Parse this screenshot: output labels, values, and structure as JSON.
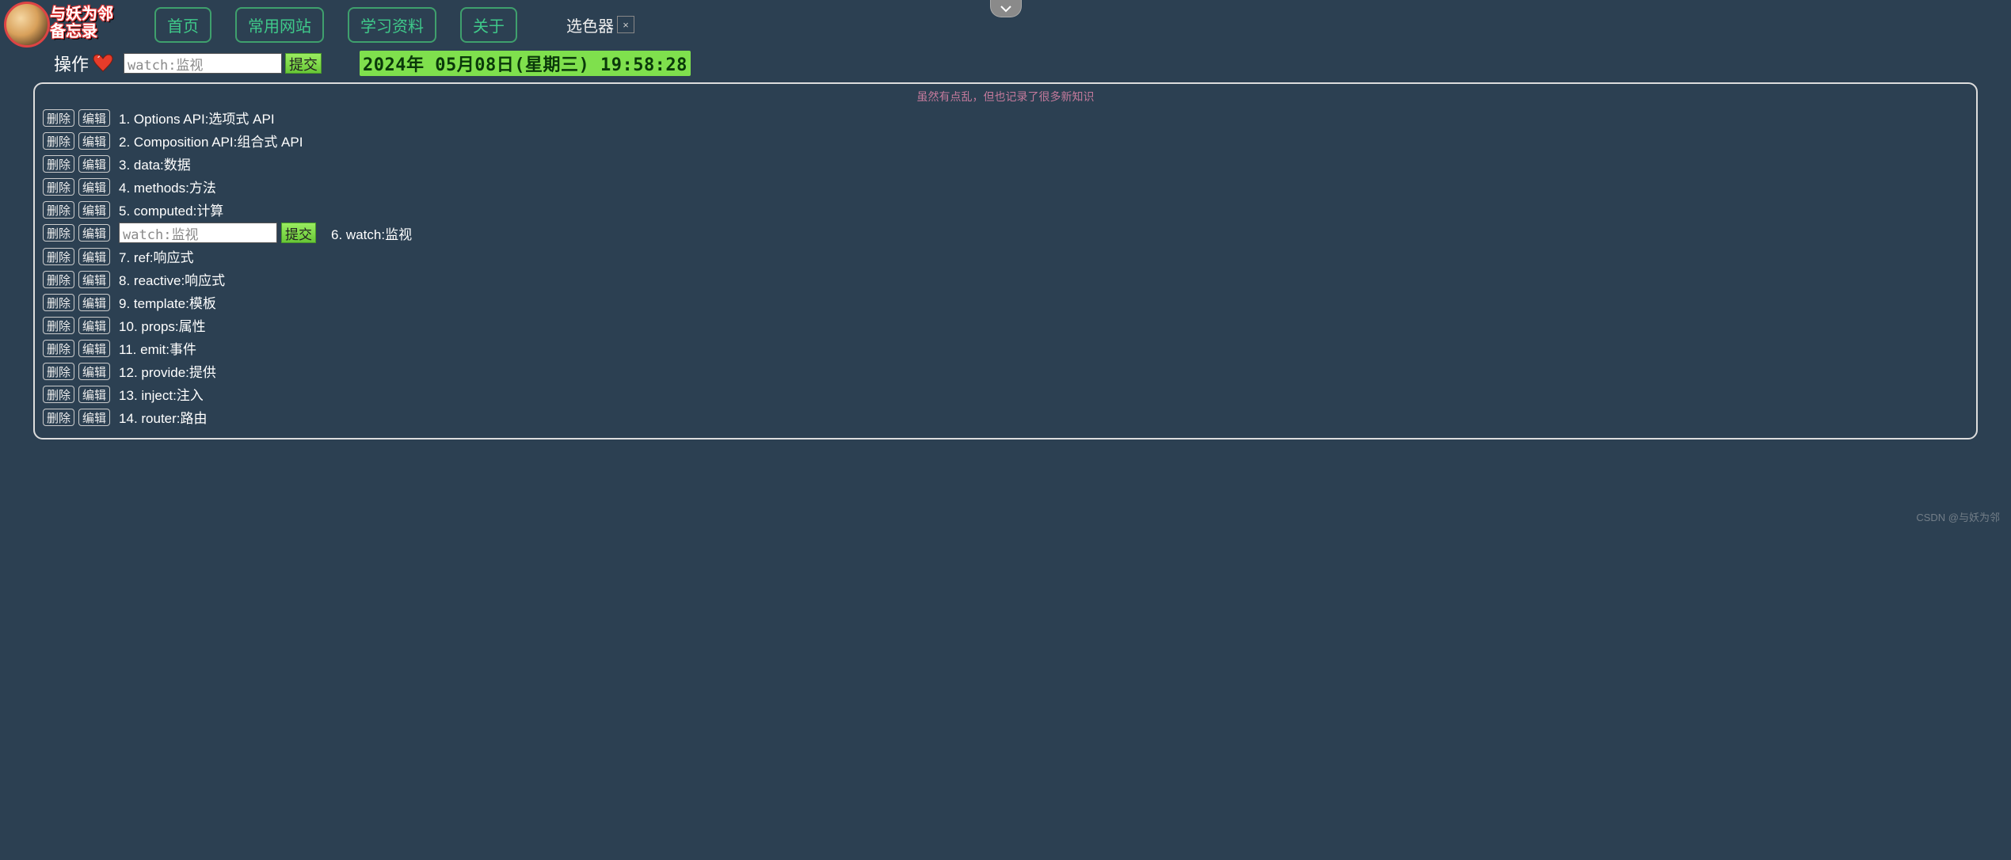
{
  "logo": {
    "line1": "与妖为邻",
    "line2": "备忘录"
  },
  "nav": {
    "home": "首页",
    "sites": "常用网站",
    "study": "学习资料",
    "about": "关于"
  },
  "color_picker": {
    "label": "选色器",
    "close": "×"
  },
  "action": {
    "op_label": "操作",
    "input_value": "watch:监视",
    "submit": "提交"
  },
  "clock": "2024年 05月08日(星期三) 19:58:28",
  "note": "虽然有点乱，但也记录了很多新知识",
  "buttons": {
    "delete": "删除",
    "edit": "编辑",
    "submit": "提交"
  },
  "editing": {
    "index": 5,
    "value": "watch:监视"
  },
  "items": [
    "1. Options API:选项式 API",
    "2. Composition API:组合式 API",
    "3. data:数据",
    "4. methods:方法",
    "5. computed:计算",
    "6. watch:监视",
    "7. ref:响应式",
    "8. reactive:响应式",
    "9. template:模板",
    "10. props:属性",
    "11. emit:事件",
    "12. provide:提供",
    "13. inject:注入",
    "14. router:路由"
  ],
  "watermark": "CSDN @与妖为邻"
}
